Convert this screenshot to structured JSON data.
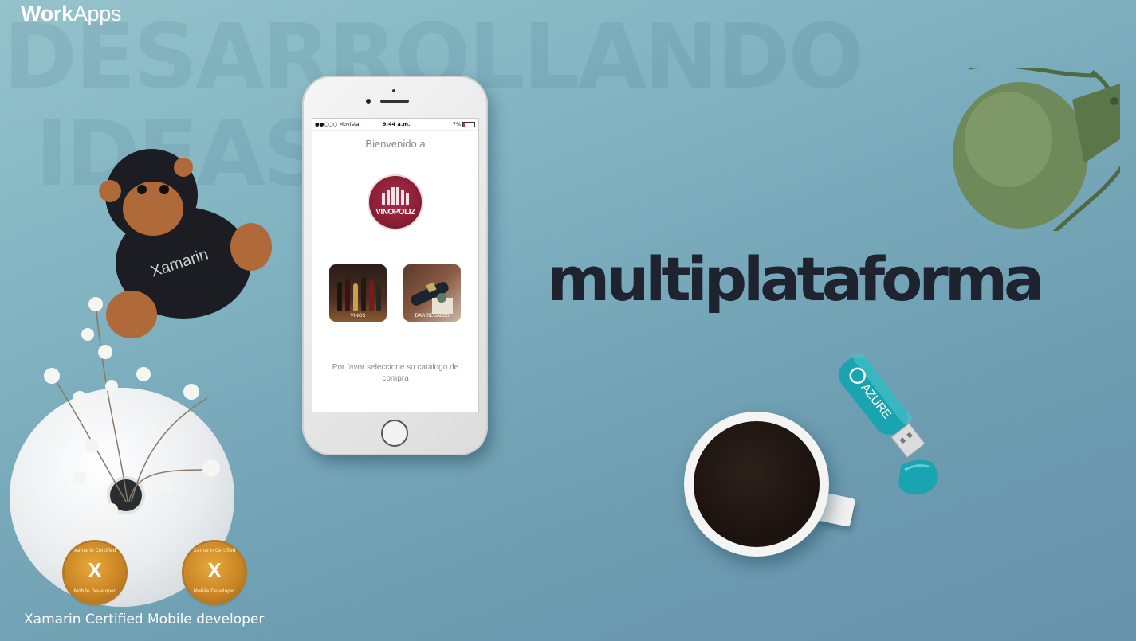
{
  "brand": {
    "work": "Work",
    "apps": "Apps"
  },
  "watermark": {
    "line1": "DESARROLLANDO",
    "line2": "IDEAS"
  },
  "headline": "multiplataforma",
  "phone": {
    "status": {
      "carrier": "●●○○○ Movistar",
      "time": "9:44 a.m.",
      "battery": "7%"
    },
    "welcome": "Bienvenido a",
    "logo_text": "VINOPOLIZ",
    "tiles": [
      {
        "label": "VINOS"
      },
      {
        "label": "DAR REGALOS"
      }
    ],
    "hint": "Por favor seleccione su catálogo de compra"
  },
  "usb_label": "AZURE",
  "monkey_label": "Xamarin",
  "badges": [
    {
      "top": "Xamarin Certified",
      "mark": "X",
      "bottom": "Mobile Developer"
    },
    {
      "top": "Xamarin Certified",
      "mark": "X",
      "bottom": "Mobile Developer"
    }
  ],
  "certification": "Xamarin Certified Mobile developer",
  "colors": {
    "headline": "#1f2330",
    "usb": "#1aa3b0",
    "wine": "#8b1e36",
    "badge": "#c98424"
  }
}
